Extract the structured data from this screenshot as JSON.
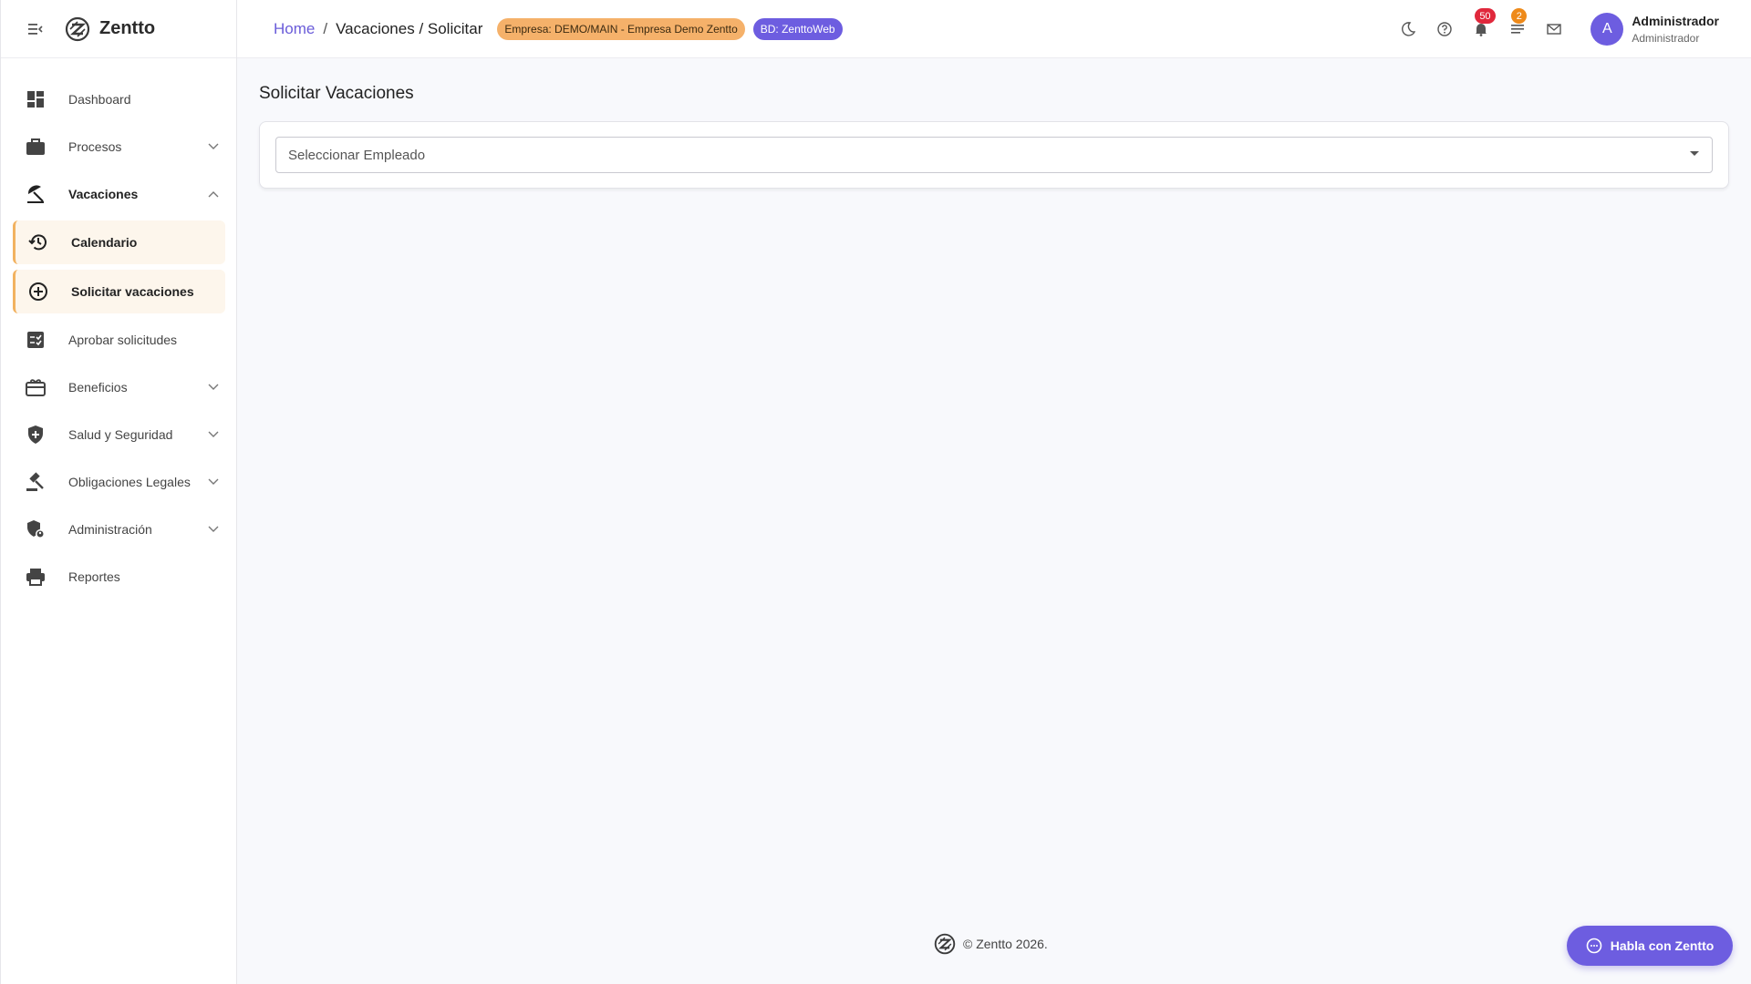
{
  "app": {
    "name": "Zentto"
  },
  "sidebar": {
    "items": [
      {
        "label": "Dashboard"
      },
      {
        "label": "Procesos"
      },
      {
        "label": "Vacaciones"
      },
      {
        "label": "Calendario"
      },
      {
        "label": "Solicitar vacaciones"
      },
      {
        "label": "Aprobar solicitudes"
      },
      {
        "label": "Beneficios"
      },
      {
        "label": "Salud y Seguridad"
      },
      {
        "label": "Obligaciones Legales"
      },
      {
        "label": "Administración"
      },
      {
        "label": "Reportes"
      }
    ]
  },
  "header": {
    "breadcrumb_home": "Home",
    "breadcrumb_sep": "/",
    "breadcrumb_current": "Vacaciones / Solicitar",
    "empresa_badge": "Empresa: DEMO/MAIN - Empresa Demo Zentto",
    "bd_badge": "BD: ZenttoWeb",
    "notifications_count": "50",
    "tasks_count": "2",
    "avatar_initial": "A",
    "user_name": "Administrador",
    "user_role": "Administrador"
  },
  "main": {
    "title": "Solicitar Vacaciones",
    "employee_select_placeholder": "Seleccionar Empleado"
  },
  "footer": {
    "text": "© Zentto 2026."
  },
  "chat": {
    "label": "Habla con Zentto"
  },
  "colors": {
    "accent": "#6d5de0",
    "empresa_badge": "#f5b16a",
    "active_item_bg": "#fdf6ec",
    "active_item_border": "#f2b260"
  }
}
